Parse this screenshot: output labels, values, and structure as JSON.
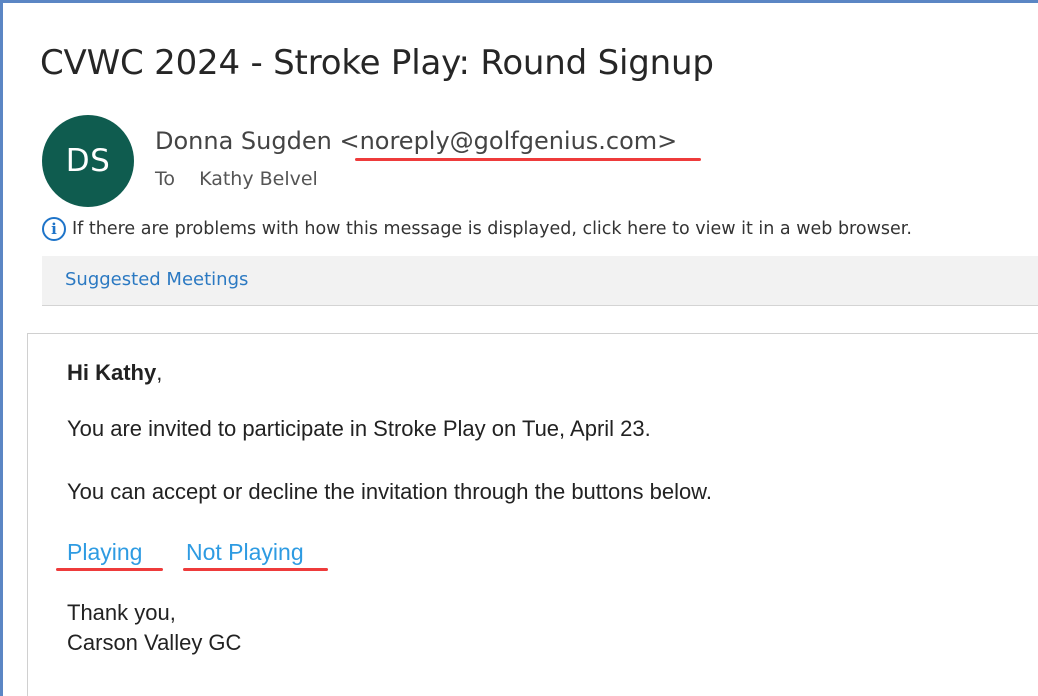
{
  "email": {
    "subject": "CVWC 2024 - Stroke Play: Round Signup",
    "avatar_initials": "DS",
    "sender_name": "Donna Sugden",
    "sender_email": "<noreply@golfgenius.com>",
    "to_label": "To",
    "recipient": "Kathy Belvel",
    "info_text": "If there are problems with how this message is displayed, click here to view it in a web browser.",
    "suggested_meetings": "Suggested Meetings"
  },
  "message": {
    "greeting_name": "Hi Kathy",
    "greeting_punct": ",",
    "line1": "You are invited to participate in Stroke Play on Tue, April 23.",
    "line2": "You can accept or decline the invitation through the buttons below.",
    "playing_label": "Playing",
    "not_playing_label": "Not Playing",
    "signoff": "Thank you,",
    "signature": "Carson Valley GC"
  },
  "colors": {
    "avatar_bg": "#0f5c4f",
    "link": "#2e9be2",
    "annotation_underline": "#ee3b3b",
    "frame_border": "#5b86c4"
  },
  "icons": {
    "info": "info-icon"
  }
}
